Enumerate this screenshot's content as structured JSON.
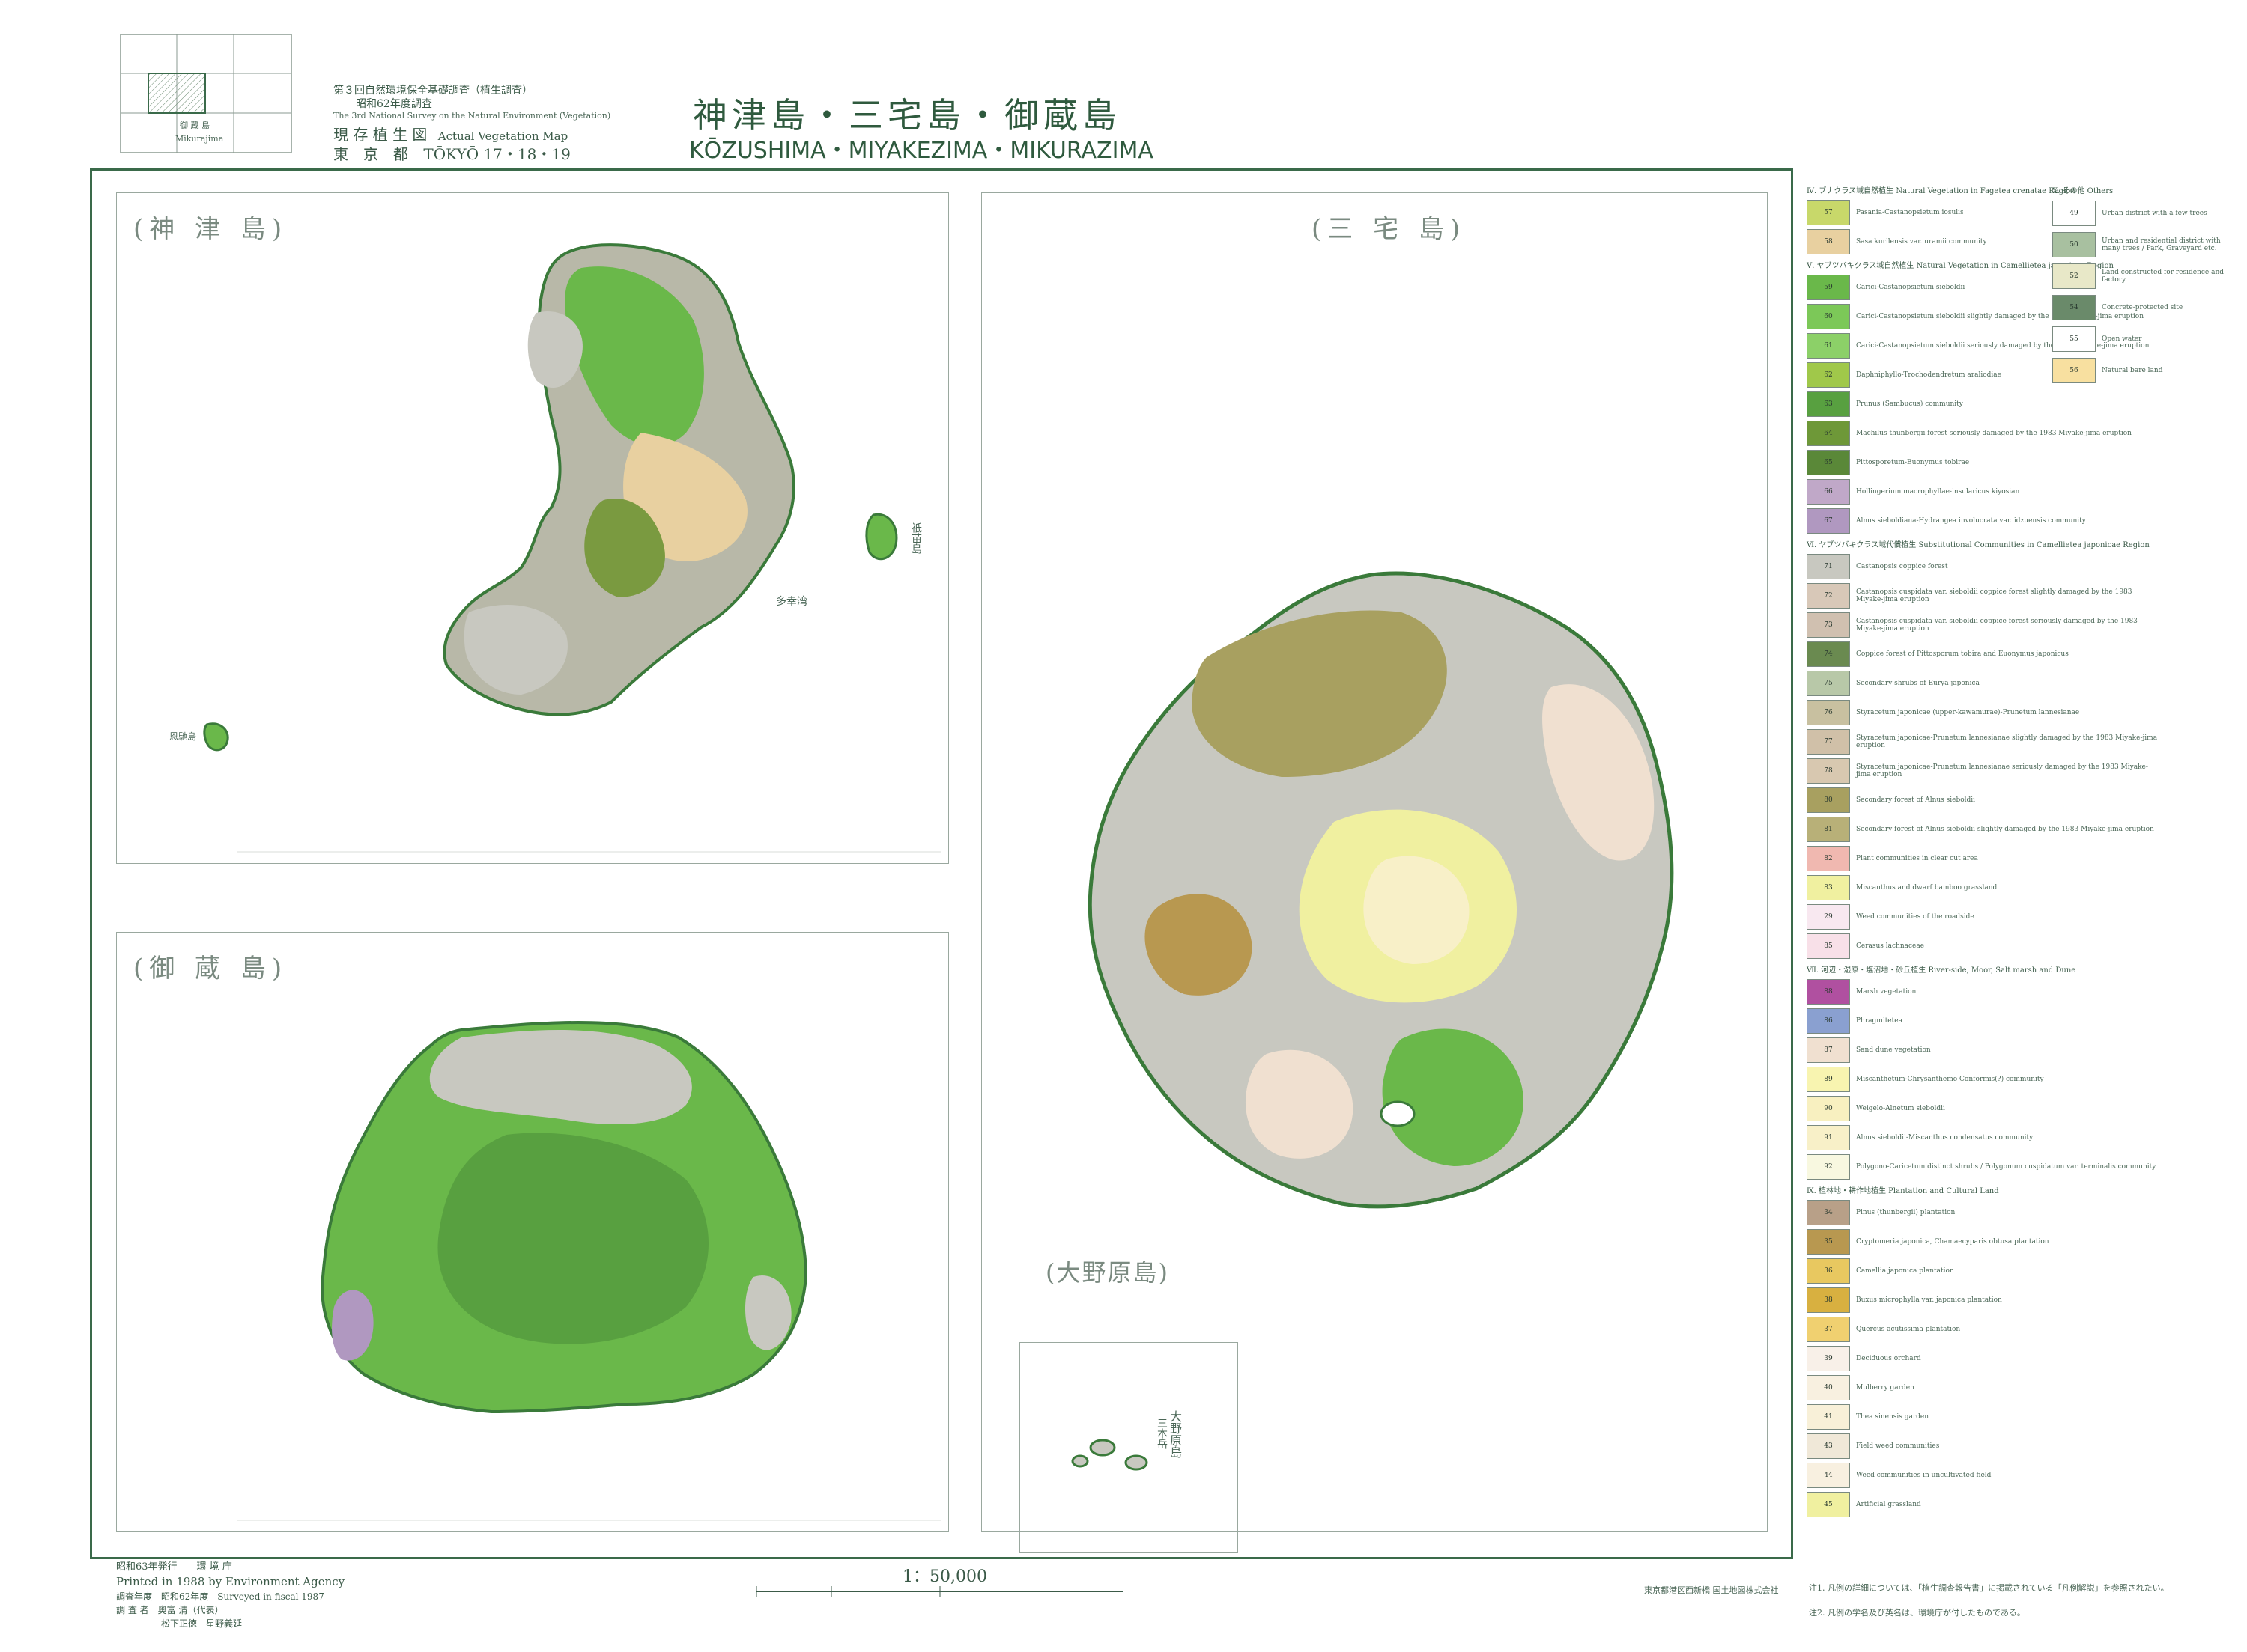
{
  "index_map": {
    "label": "御 蔵 島",
    "sublabel": "Mikurajima"
  },
  "header": {
    "survey_line1": "第３回自然環境保全基礎調査（植生調査）",
    "survey_line2": "昭和62年度調査",
    "survey_en": "The 3rd National Survey on the Natural Environment (Vegetation)",
    "map_kind_jp": "現 存 植 生 図",
    "map_kind_en": "Actual Vegetation Map",
    "prefecture": "東　京　都",
    "sheet": "TŌKYŌ 17・18・19",
    "title_jp": "神津島・三宅島・御蔵島",
    "title_en": "KŌZUSHIMA・MIYAKEZIMA・MIKURAZIMA"
  },
  "panels": {
    "kozu": "(神 津 島)",
    "mikura": "(御 蔵 島)",
    "miyake": "(三 宅 島)",
    "onohara": "(大野原島)"
  },
  "place_labels": {
    "kozu_east_island": "祗苗島",
    "kozu_bay": "多幸湾",
    "kozu_west_islet": "恩馳島",
    "onohara_side": "大野原島",
    "onohara_side2": "三本岳"
  },
  "footer": {
    "issued": "昭和63年発行　　環 境 庁",
    "printed": "Printed in 1988 by Environment Agency",
    "surveyed": "調査年度　昭和62年度　Surveyed in fiscal 1987",
    "surveyor": "調 査 者　奥富 清（代表）",
    "surveyor2": "松下正徳　星野義延",
    "scale": "1：50,000",
    "printer": "東京都港区西新橋 国土地図株式会社"
  },
  "legend": {
    "sections": [
      {
        "title": "Ⅳ. ブナクラス域自然植生 Natural Vegetation in Fagetea crenatae Region",
        "items": [
          {
            "code": "57",
            "label": "Pasania-Castanopsietum iosulis",
            "color": "#c8d86a"
          },
          {
            "code": "58",
            "label": "Sasa kurilensis var. uramii community",
            "color": "#e8d0a0"
          }
        ]
      },
      {
        "title": "Ⅴ. ヤブツバキクラス域自然植生 Natural Vegetation in Camellietea japonicae Region",
        "items": [
          {
            "code": "59",
            "label": "Carici-Castanopsietum sieboldii",
            "color": "#6ab84a"
          },
          {
            "code": "60",
            "label": "Carici-Castanopsietum sieboldii slightly damaged by the 1983 Miyake-jima eruption",
            "color": "#7cc858"
          },
          {
            "code": "61",
            "label": "Carici-Castanopsietum sieboldii seriously damaged by the 1983 Miyake-jima eruption",
            "color": "#8cd068"
          },
          {
            "code": "62",
            "label": "Daphniphyllo-Trochodendretum araliodiae",
            "color": "#a0c84a"
          },
          {
            "code": "63",
            "label": "Prunus (Sambucus) community",
            "color": "#58a040"
          },
          {
            "code": "64",
            "label": "Machilus thunbergii forest seriously damaged by the 1983 Miyake-jima eruption",
            "color": "#6e9838"
          },
          {
            "code": "65",
            "label": "Pittosporetum-Euonymus tobirae",
            "color": "#5a8838"
          },
          {
            "code": "66",
            "label": "Hollingerium macrophyllae-insularicus kiyosian",
            "color": "#c0a8c8"
          },
          {
            "code": "67",
            "label": "Alnus sieboldiana-Hydrangea involucrata var. idzuensis community",
            "color": "#b098c0"
          }
        ]
      },
      {
        "title": "Ⅵ. ヤブツバキクラス域代償植生 Substitutional Communities in Camellietea japonicae Region",
        "items": [
          {
            "code": "71",
            "label": "Castanopsis coppice forest",
            "color": "#c8c8c0"
          },
          {
            "code": "72",
            "label": "Castanopsis cuspidata var. sieboldii coppice forest slightly damaged by the 1983 Miyake-jima eruption",
            "color": "#d8c8b8"
          },
          {
            "code": "73",
            "label": "Castanopsis cuspidata var. sieboldii coppice forest seriously damaged by the 1983 Miyake-jima eruption",
            "color": "#d0c0b0"
          },
          {
            "code": "74",
            "label": "Coppice forest of Pittosporum tobira and Euonymus japonicus",
            "color": "#6a8a50"
          },
          {
            "code": "75",
            "label": "Secondary shrubs of Eurya japonica",
            "color": "#b8c8a8"
          },
          {
            "code": "76",
            "label": "Styracetum japonicae (upper-kawamurae)-Prunetum lannesianae",
            "color": "#c8c0a0"
          },
          {
            "code": "77",
            "label": "Styracetum japonicae-Prunetum lannesianae slightly damaged by the 1983 Miyake-jima eruption",
            "color": "#d0c0a8"
          },
          {
            "code": "78",
            "label": "Styracetum japonicae-Prunetum lannesianae seriously damaged by the 1983 Miyake-jima eruption",
            "color": "#d8c8b0"
          },
          {
            "code": "80",
            "label": "Secondary forest of Alnus sieboldii",
            "color": "#a8a060"
          },
          {
            "code": "81",
            "label": "Secondary forest of Alnus sieboldii slightly damaged by the 1983 Miyake-jima eruption",
            "color": "#b8b078"
          },
          {
            "code": "82",
            "label": "Plant communities in clear cut area",
            "color": "#f0b8b0"
          },
          {
            "code": "83",
            "label": "Miscanthus and dwarf bamboo grassland",
            "color": "#f0f0a0"
          },
          {
            "code": "29",
            "label": "Weed communities of the roadside",
            "color": "#f8e8f0"
          },
          {
            "code": "85",
            "label": "Cerasus lachnaceae",
            "color": "#f8e0e8"
          }
        ]
      },
      {
        "title": "Ⅶ. 河辺・湿原・塩沼地・砂丘植生 River-side, Moor, Salt marsh and Dune",
        "items": [
          {
            "code": "88",
            "label": "Marsh vegetation",
            "color": "#b050a0"
          },
          {
            "code": "86",
            "label": "Phragmitetea",
            "color": "#8aa0d0"
          },
          {
            "code": "87",
            "label": "Sand dune vegetation",
            "color": "#f0e0d0"
          },
          {
            "code": "89",
            "label": "Miscanthetum-Chrysanthemo Conformis(?) community",
            "color": "#f8f4b0"
          },
          {
            "code": "90",
            "label": "Weigelo-Alnetum sieboldii",
            "color": "#f8f0c0"
          },
          {
            "code": "91",
            "label": "Alnus sieboldii-Miscanthus condensatus community",
            "color": "#f8f0c8"
          },
          {
            "code": "92",
            "label": "Polygono-Caricetum distinct shrubs / Polygonum cuspidatum var. terminalis community",
            "color": "#f8f8e0"
          }
        ]
      },
      {
        "title": "Ⅸ. 植林地・耕作地植生 Plantation and Cultural Land",
        "items": [
          {
            "code": "34",
            "label": "Pinus (thunbergii) plantation",
            "color": "#b8a088"
          },
          {
            "code": "35",
            "label": "Cryptomeria japonica, Chamaecyparis obtusa plantation",
            "color": "#b89850"
          },
          {
            "code": "36",
            "label": "Camellia japonica plantation",
            "color": "#e8c860"
          },
          {
            "code": "38",
            "label": "Buxus microphylla var. japonica plantation",
            "color": "#d8b040"
          },
          {
            "code": "37",
            "label": "Quercus acutissima plantation",
            "color": "#f0d070"
          },
          {
            "code": "39",
            "label": "Deciduous orchard",
            "color": "#f8f0e8"
          },
          {
            "code": "40",
            "label": "Mulberry garden",
            "color": "#f8f0e0"
          },
          {
            "code": "41",
            "label": "Thea sinensis garden",
            "color": "#f8f0d8"
          },
          {
            "code": "43",
            "label": "Field weed communities",
            "color": "#f0e8d8"
          },
          {
            "code": "44",
            "label": "Weed communities in uncultivated field",
            "color": "#f8f0e0"
          },
          {
            "code": "45",
            "label": "Artificial grassland",
            "color": "#f0f0a0"
          }
        ]
      }
    ],
    "others": {
      "title": "Ⅹ. その他 Others",
      "items": [
        {
          "code": "49",
          "label": "Urban district with a few trees",
          "color": "#ffffff"
        },
        {
          "code": "50",
          "label": "Urban and residential district with many trees / Park, Graveyard etc.",
          "color": "#a8c0a0"
        },
        {
          "code": "52",
          "label": "Land constructed for residence and factory",
          "color": "#e8e8c8"
        },
        {
          "code": "54",
          "label": "Concrete-protected site",
          "color": "#6a8a6a"
        },
        {
          "code": "55",
          "label": "Open water",
          "color": "#ffffff"
        },
        {
          "code": "56",
          "label": "Natural bare land",
          "color": "#f8e0a0"
        }
      ]
    }
  },
  "notes": {
    "n1": "注1. 凡例の詳細については、「植生調査報告書」に掲載されている「凡例解説」を参照されたい。",
    "n2": "注2. 凡例の学名及び英名は、環境庁が付したものである。"
  }
}
